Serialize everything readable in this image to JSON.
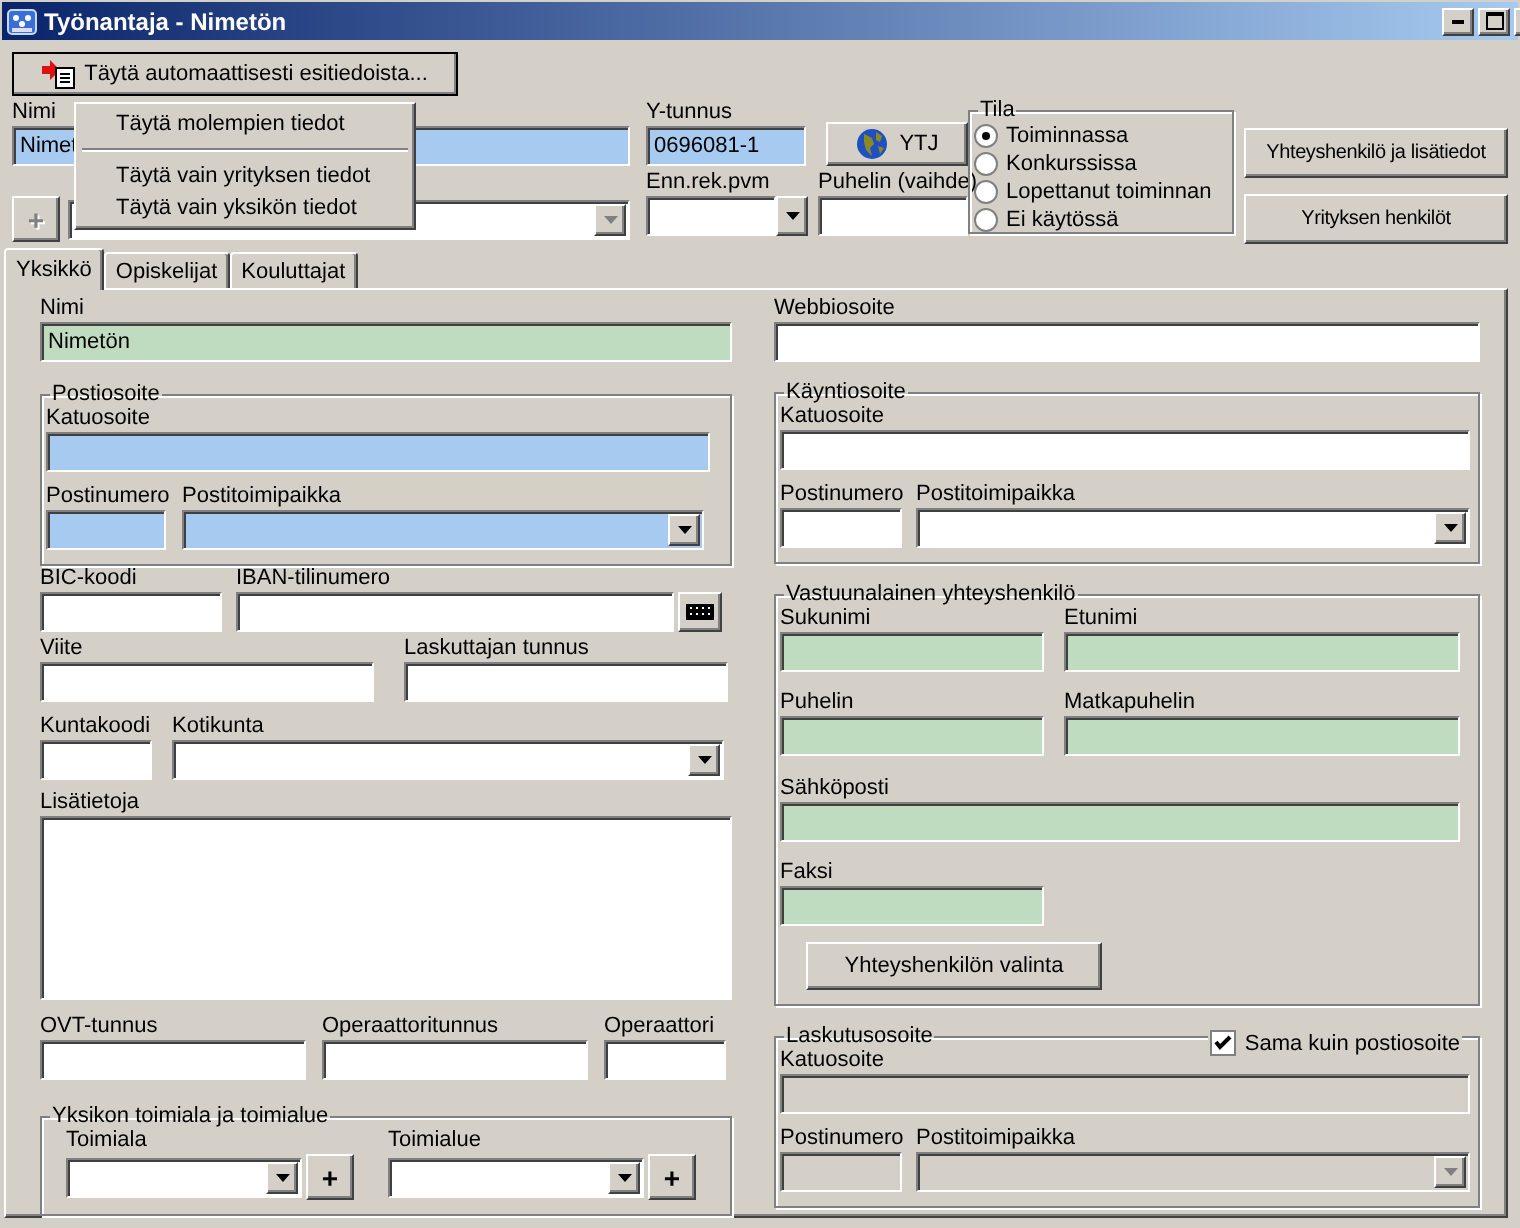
{
  "window": {
    "title": "Työnantaja - Nimetön"
  },
  "autofill_button": {
    "label": "Täytä automaattisesti esitiedoista..."
  },
  "autofill_menu": [
    {
      "kind": "item",
      "label": "Täytä molempien tiedot"
    },
    {
      "kind": "separator"
    },
    {
      "kind": "item",
      "label": "Täytä vain yrityksen tiedot"
    },
    {
      "kind": "item",
      "label": "Täytä vain yksikön tiedot"
    }
  ],
  "employer": {
    "name": {
      "kind": "text",
      "label": "Nimi",
      "value": "Nimet",
      "color": "#a6caf0"
    },
    "add_button": {
      "label": "+",
      "disabled": true
    },
    "unit_select": {
      "kind": "combo",
      "color": "#ffffff",
      "disabled": true
    },
    "business_id": {
      "kind": "text",
      "label": "Y-tunnus",
      "value": "0696081-1",
      "color": "#a6caf0"
    },
    "ytj_button": {
      "label": "YTJ"
    },
    "prereg_date": {
      "kind": "date",
      "label": "Enn.rek.pvm"
    },
    "phone": {
      "kind": "text",
      "label": "Puhelin (vaihde)"
    },
    "status": {
      "title": "Tila",
      "options": [
        {
          "label": "Toiminnassa",
          "selected": true
        },
        {
          "label": "Konkurssissa",
          "selected": false
        },
        {
          "label": "Lopettanut toiminnan",
          "selected": false
        },
        {
          "label": "Ei käytössä",
          "selected": false
        }
      ]
    },
    "buttons": [
      "Yhteyshenkilö ja lisätiedot",
      "Yrityksen henkilöt"
    ]
  },
  "tabs": [
    {
      "label": "Yksikkö",
      "selected": true
    },
    {
      "label": "Opiskelijat",
      "selected": false
    },
    {
      "label": "Kouluttajat",
      "selected": false
    }
  ],
  "unit": {
    "name": {
      "kind": "text",
      "label": "Nimi",
      "value": "Nimetön",
      "color": "#c0dcc0"
    },
    "postal_address": {
      "title": "Postiosoite",
      "street": {
        "kind": "text",
        "label": "Katuosoite",
        "color": "#a6caf0"
      },
      "postcode": {
        "kind": "text",
        "label": "Postinumero",
        "color": "#a6caf0"
      },
      "city": {
        "kind": "combo",
        "label": "Postitoimipaikka",
        "color": "#a6caf0"
      }
    },
    "bic": {
      "kind": "text",
      "label": "BIC-koodi"
    },
    "iban": {
      "kind": "text",
      "label": "IBAN-tilinumero"
    },
    "reference": {
      "kind": "text",
      "label": "Viite"
    },
    "biller_id": {
      "kind": "text",
      "label": "Laskuttajan tunnus"
    },
    "municipality_code": {
      "kind": "text",
      "label": "Kuntakoodi"
    },
    "home_municipality": {
      "kind": "combo",
      "label": "Kotikunta"
    },
    "notes": {
      "kind": "textarea",
      "label": "Lisätietoja"
    },
    "ovt": {
      "kind": "text",
      "label": "OVT-tunnus"
    },
    "operator_id": {
      "kind": "text",
      "label": "Operaattoritunnus"
    },
    "operator": {
      "kind": "text",
      "label": "Operaattori"
    },
    "industry": {
      "title": "Yksikon toimiala ja toimialue",
      "sector": {
        "kind": "combo",
        "label": "Toimiala"
      },
      "sector_add": "+",
      "area": {
        "kind": "combo",
        "label": "Toimialue"
      },
      "area_add": "+"
    },
    "web": {
      "kind": "text",
      "label": "Webbiosoite"
    },
    "visiting_address": {
      "title": "Käyntiosoite",
      "street": {
        "kind": "text",
        "label": "Katuosoite"
      },
      "postcode": {
        "kind": "text",
        "label": "Postinumero"
      },
      "city": {
        "kind": "combo",
        "label": "Postitoimipaikka"
      }
    },
    "contact": {
      "title": "Vastuunalainen yhteyshenkilö",
      "last_name": {
        "kind": "text",
        "label": "Sukunimi",
        "color": "#c0dcc0"
      },
      "first_name": {
        "kind": "text",
        "label": "Etunimi",
        "color": "#c0dcc0"
      },
      "phone": {
        "kind": "text",
        "label": "Puhelin",
        "color": "#c0dcc0"
      },
      "mobile": {
        "kind": "text",
        "label": "Matkapuhelin",
        "color": "#c0dcc0"
      },
      "email": {
        "kind": "text",
        "label": "Sähköposti",
        "color": "#c0dcc0"
      },
      "fax": {
        "kind": "text",
        "label": "Faksi",
        "color": "#c0dcc0"
      },
      "select_button": "Yhteyshenkilön valinta"
    },
    "billing_address": {
      "title": "Laskutusosoite",
      "same_as_postal": {
        "label": "Sama kuin postiosoite",
        "checked": true
      },
      "street": {
        "kind": "text",
        "label": "Katuosoite",
        "disabled": true
      },
      "postcode": {
        "kind": "text",
        "label": "Postinumero",
        "disabled": true
      },
      "city": {
        "kind": "combo",
        "label": "Postitoimipaikka",
        "disabled": true
      }
    }
  }
}
